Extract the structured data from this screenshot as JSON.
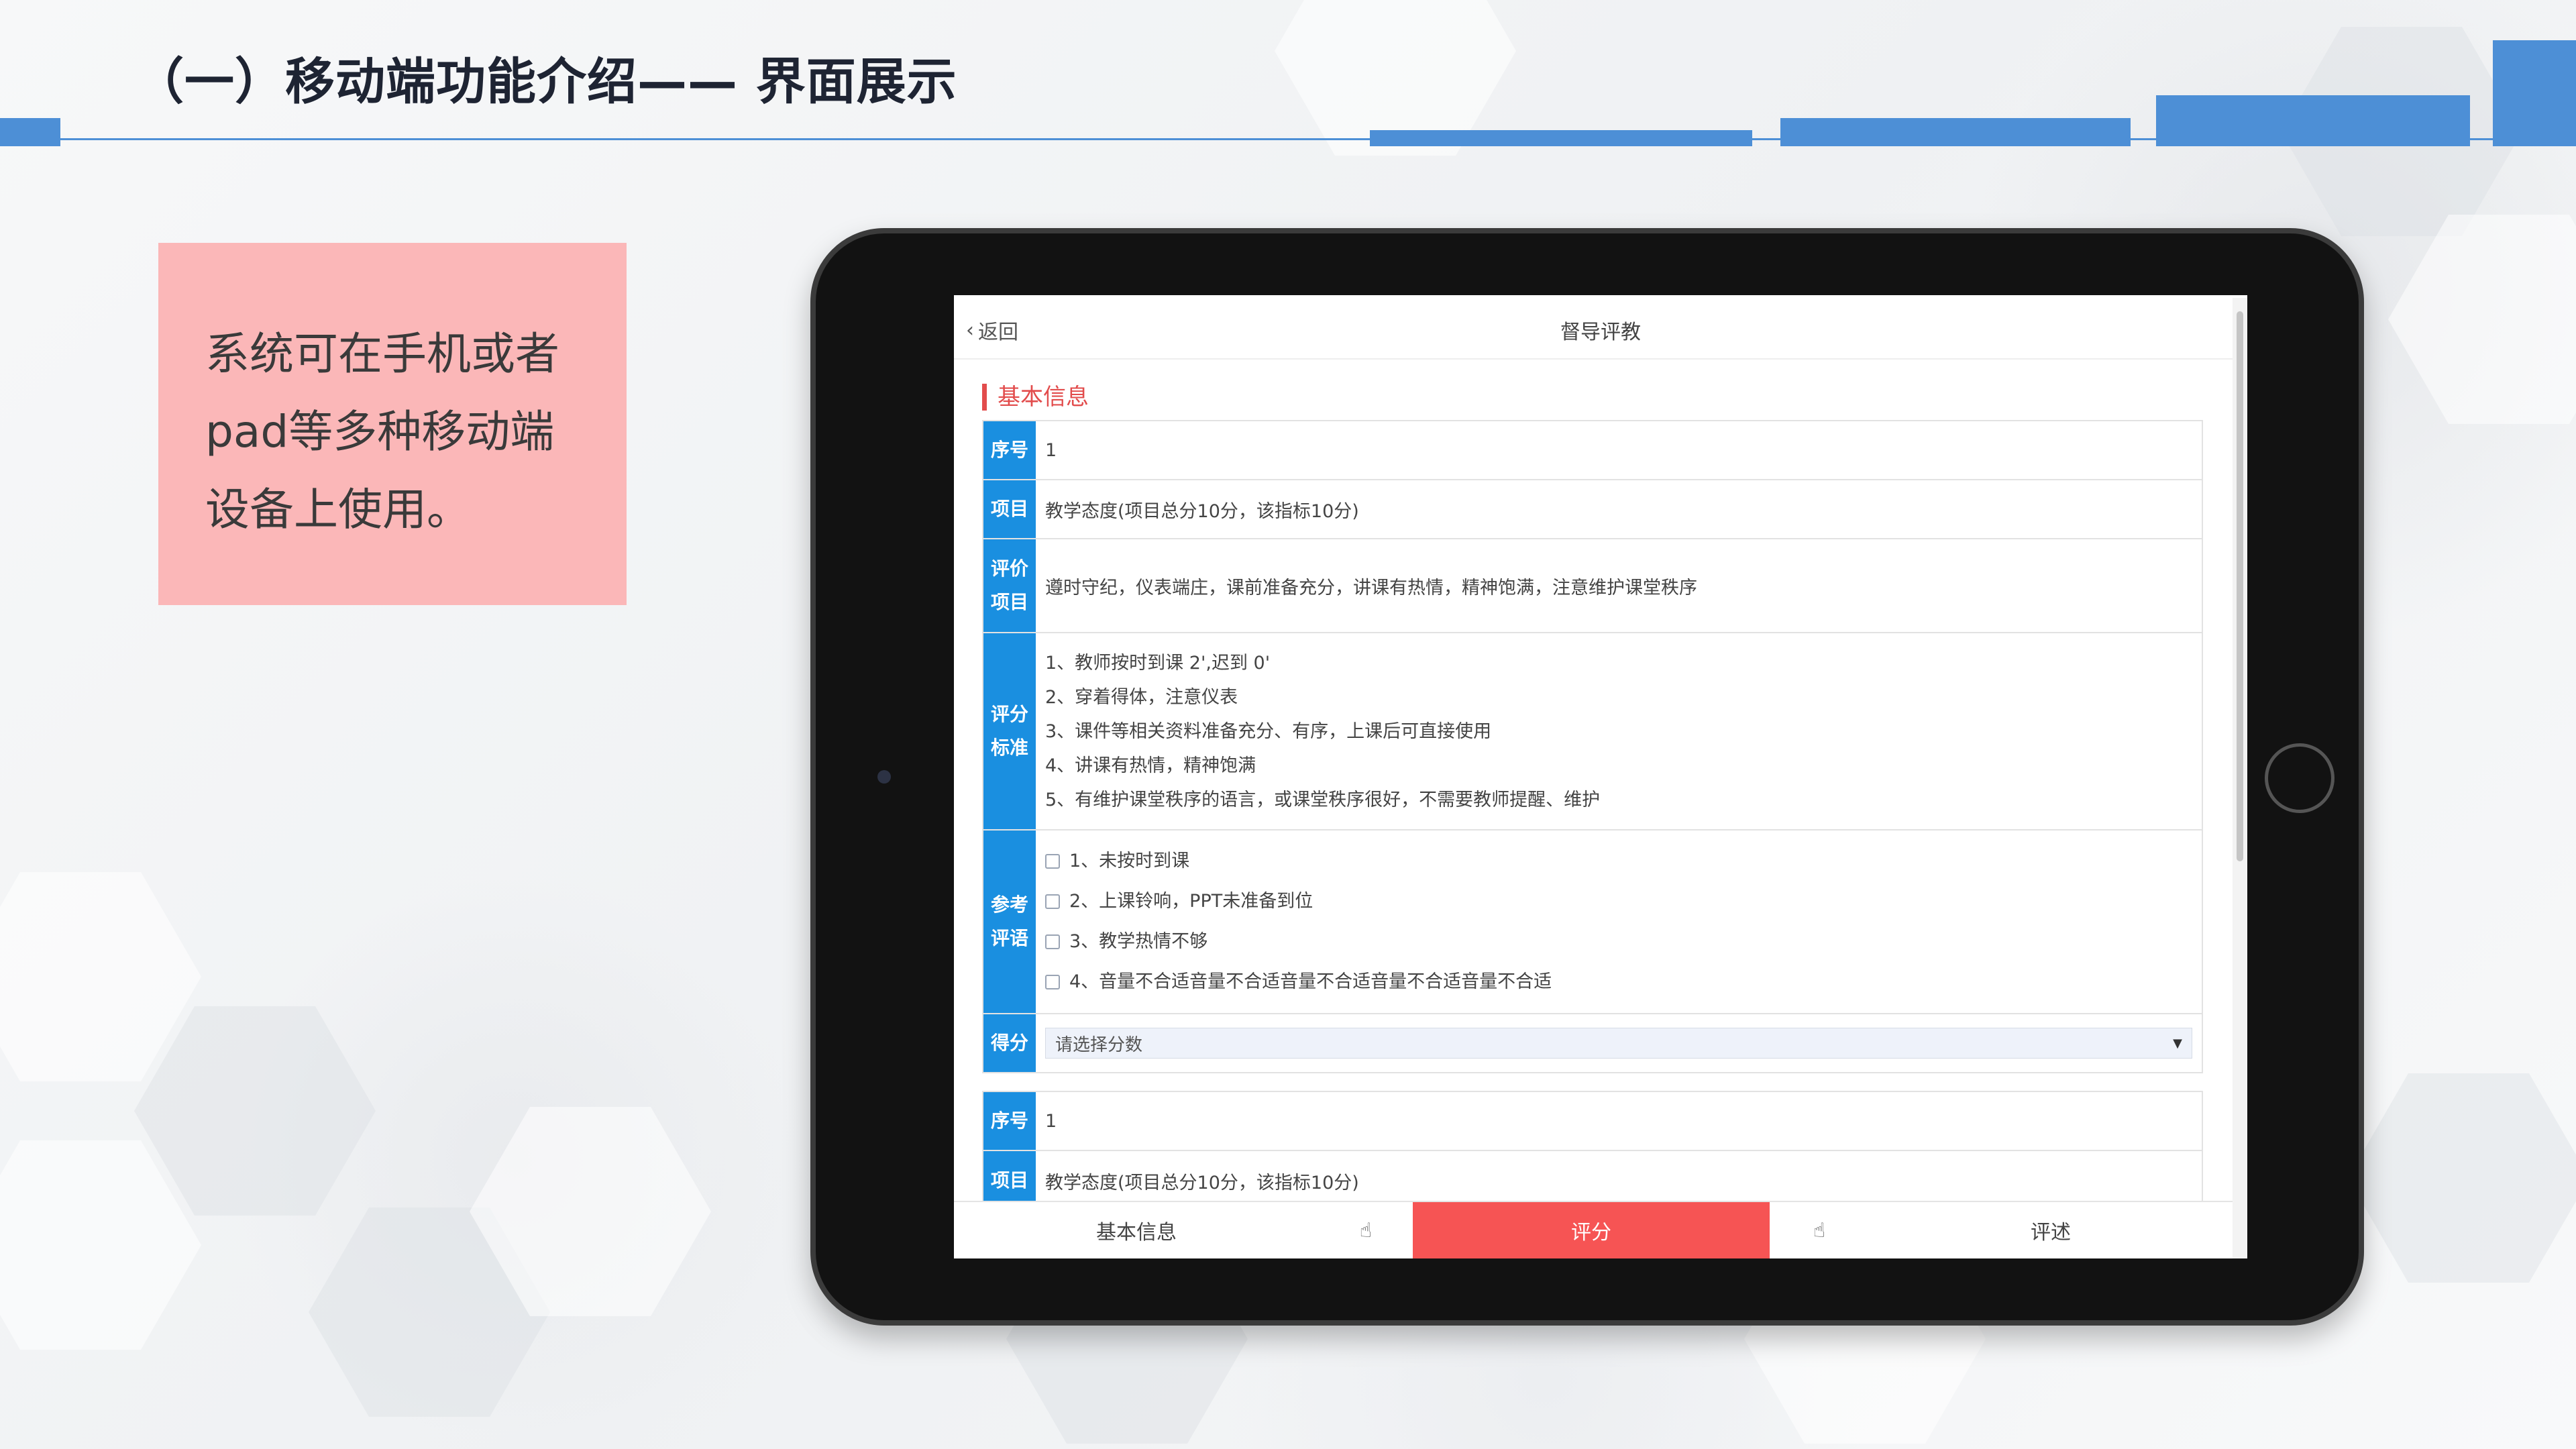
{
  "slide": {
    "title": "（一）移动端功能介绍—— 界面展示",
    "accent_color": "#4d8fd6",
    "callout_color": "#fbb7b8"
  },
  "callout": {
    "lines": [
      "系统可在手机或者",
      "pad等多种移动端",
      "设备上使用。"
    ]
  },
  "app": {
    "back_label": "返回",
    "title": "督导评教",
    "section_title": "基本信息",
    "label_color": "#1a8fe0",
    "record1": {
      "seq_label": "序号",
      "seq_value": "1",
      "item_label": "项目",
      "item_value": "教学态度(项目总分10分，该指标10分)",
      "eval_label_1": "评价",
      "eval_label_2": "项目",
      "eval_value": "遵时守纪，仪表端庄，课前准备充分，讲课有热情，精神饱满，注意维护课堂秩序",
      "criteria_label_1": "评分",
      "criteria_label_2": "标准",
      "criteria": [
        "1、教师按时到课 2',迟到 0'",
        "2、穿着得体，注意仪表",
        "3、课件等相关资料准备充分、有序，上课后可直接使用",
        "4、讲课有热情，精神饱满",
        "5、有维护课堂秩序的语言，或课堂秩序很好，不需要教师提醒、维护"
      ],
      "ref_label_1": "参考",
      "ref_label_2": "评语",
      "references": [
        "1、未按时到课",
        "2、上课铃响，PPT未准备到位",
        "3、教学热情不够",
        "4、音量不合适音量不合适音量不合适音量不合适音量不合适"
      ],
      "score_label": "得分",
      "score_placeholder": "请选择分数"
    },
    "record2": {
      "seq_label": "序号",
      "seq_value": "1",
      "item_label": "项目",
      "item_value": "教学态度(项目总分10分，该指标10分)"
    },
    "tabs": {
      "basic": "基本信息",
      "score": "评分",
      "review": "评述",
      "active_color": "#f65454"
    }
  }
}
